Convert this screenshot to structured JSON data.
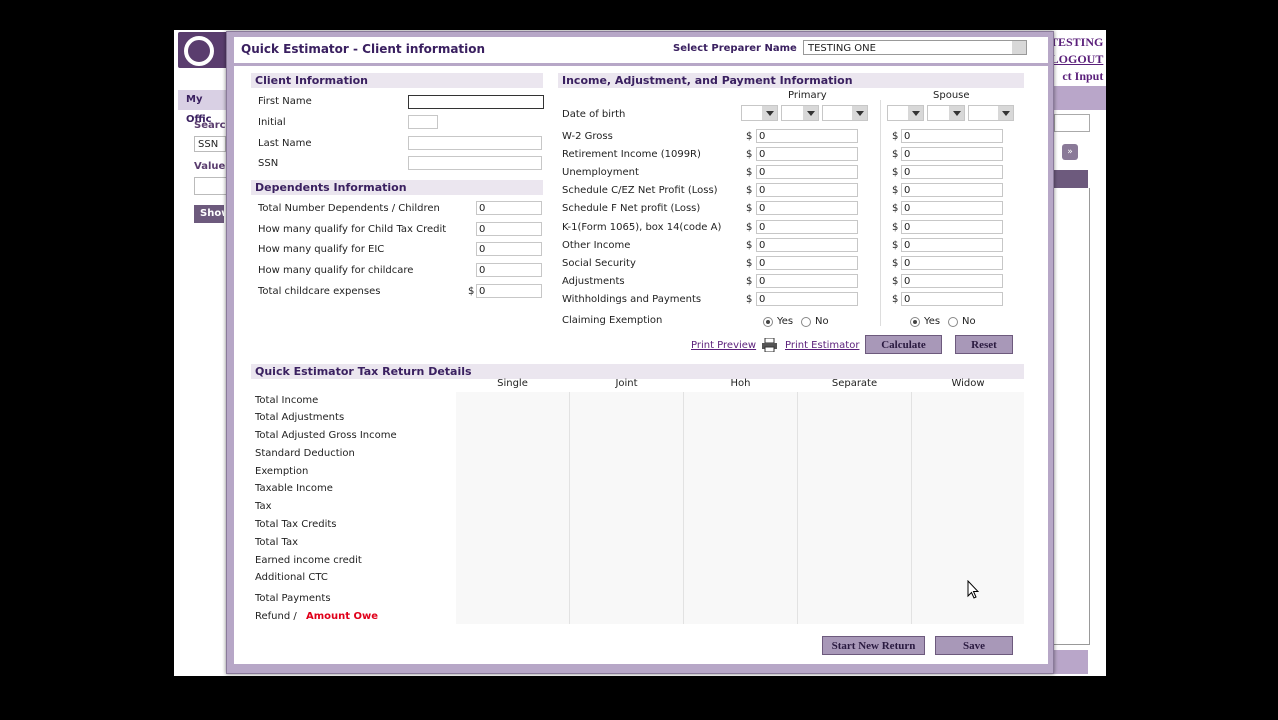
{
  "background": {
    "my_office": "My Offic",
    "search_label": "Searc",
    "search_value": "SSN",
    "value_label": "Value",
    "show_button": "Show",
    "links": [
      "TESTING",
      "LOGOUT",
      "ct Input"
    ]
  },
  "dialog": {
    "title": "Quick Estimator - Client information",
    "preparer_label": "Select Preparer Name",
    "preparer_value": "TESTING ONE"
  },
  "client": {
    "header": "Client Information",
    "first_name": "First Name",
    "initial": "Initial",
    "last_name": "Last Name",
    "ssn": "SSN"
  },
  "dependents": {
    "header": "Dependents Information",
    "rows": [
      {
        "label": "Total Number Dependents / Children",
        "value": "0"
      },
      {
        "label": "How many qualify for Child Tax Credit",
        "value": "0"
      },
      {
        "label": "How many qualify for EIC",
        "value": "0"
      },
      {
        "label": "How many qualify for childcare",
        "value": "0"
      },
      {
        "label": "Total childcare expenses",
        "value": "0",
        "currency": "$"
      }
    ]
  },
  "income": {
    "header": "Income, Adjustment, and Payment Information",
    "primary_label": "Primary",
    "spouse_label": "Spouse",
    "dob_label": "Date of birth",
    "currency": "$",
    "rows": [
      {
        "label": "W-2 Gross",
        "primary": "0",
        "spouse": "0"
      },
      {
        "label": "Retirement Income (1099R)",
        "primary": "0",
        "spouse": "0"
      },
      {
        "label": "Unemployment",
        "primary": "0",
        "spouse": "0"
      },
      {
        "label": "Schedule C/EZ Net Profit (Loss)",
        "primary": "0",
        "spouse": "0"
      },
      {
        "label": "Schedule F Net profit (Loss)",
        "primary": "0",
        "spouse": "0"
      },
      {
        "label": "K-1(Form 1065), box 14(code A)",
        "primary": "0",
        "spouse": "0"
      },
      {
        "label": "Other Income",
        "primary": "0",
        "spouse": "0"
      },
      {
        "label": "Social Security",
        "primary": "0",
        "spouse": "0"
      },
      {
        "label": "Adjustments",
        "primary": "0",
        "spouse": "0"
      },
      {
        "label": "Withholdings and Payments",
        "primary": "0",
        "spouse": "0"
      }
    ],
    "exemption_label": "Claiming Exemption",
    "yes": "Yes",
    "no": "No",
    "primary_exemption": "Yes",
    "spouse_exemption": "Yes"
  },
  "actions": {
    "print_preview": "Print Preview",
    "print_estimator": "Print Estimator",
    "calculate": "Calculate",
    "reset": "Reset"
  },
  "details": {
    "header": "Quick Estimator Tax Return Details",
    "columns": [
      "Single",
      "Joint",
      "Hoh",
      "Separate",
      "Widow"
    ],
    "rows": [
      "Total Income",
      "Total Adjustments",
      "Total Adjusted Gross Income",
      "Standard Deduction",
      "Exemption",
      "Taxable Income",
      "Tax",
      "Total Tax Credits",
      "Total Tax",
      "Earned income credit",
      "Additional CTC",
      "Total Payments"
    ],
    "refund_label": "Refund /",
    "amount_owe_label": "Amount Owe"
  },
  "footer": {
    "start_new": "Start New Return",
    "save": "Save"
  }
}
